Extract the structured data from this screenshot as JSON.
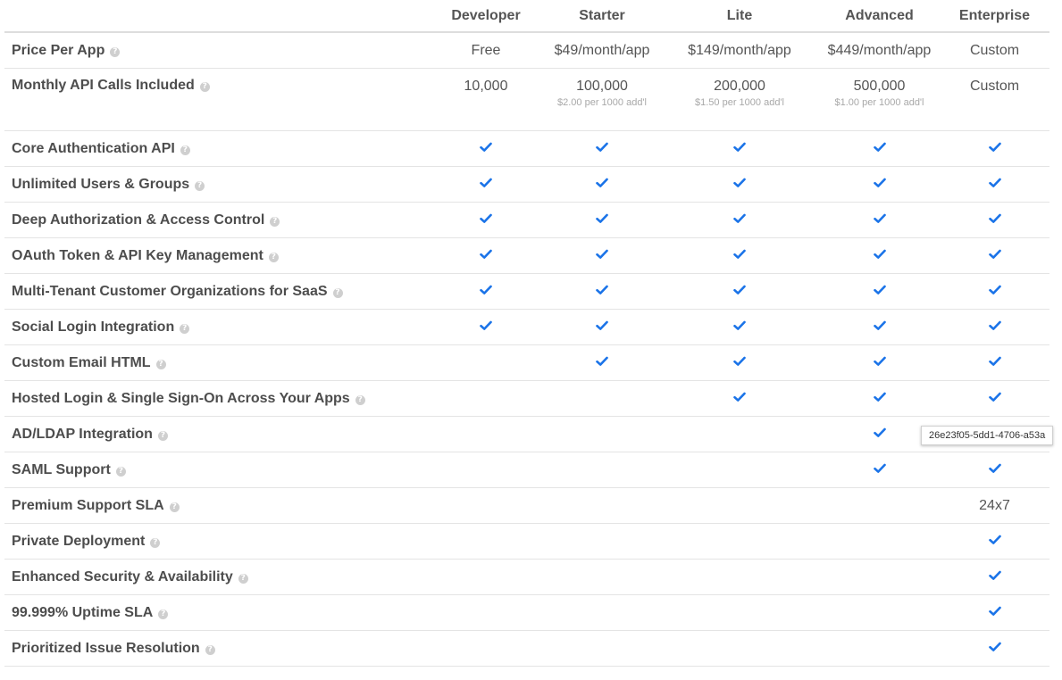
{
  "plans": [
    "Developer",
    "Starter",
    "Lite",
    "Advanced",
    "Enterprise"
  ],
  "colors": {
    "check": "#1a73e8",
    "help_icon": "#cfcfcf",
    "row_border": "#e4e4e4"
  },
  "rows": [
    {
      "label": "Price Per App",
      "cells": [
        {
          "text": "Free"
        },
        {
          "text": "$49/month/app"
        },
        {
          "text": "$149/month/app"
        },
        {
          "text": "$449/month/app"
        },
        {
          "text": "Custom"
        }
      ]
    },
    {
      "label": "Monthly API Calls Included",
      "cells": [
        {
          "text": "10,000"
        },
        {
          "text": "100,000",
          "sub": "$2.00 per 1000 add'l"
        },
        {
          "text": "200,000",
          "sub": "$1.50 per 1000 add'l"
        },
        {
          "text": "500,000",
          "sub": "$1.00 per 1000 add'l"
        },
        {
          "text": "Custom"
        }
      ]
    },
    {
      "label": "Core Authentication API",
      "cells": [
        {
          "check": true
        },
        {
          "check": true
        },
        {
          "check": true
        },
        {
          "check": true
        },
        {
          "check": true
        }
      ]
    },
    {
      "label": "Unlimited Users & Groups",
      "cells": [
        {
          "check": true
        },
        {
          "check": true
        },
        {
          "check": true
        },
        {
          "check": true
        },
        {
          "check": true
        }
      ]
    },
    {
      "label": "Deep Authorization & Access Control",
      "cells": [
        {
          "check": true
        },
        {
          "check": true
        },
        {
          "check": true
        },
        {
          "check": true
        },
        {
          "check": true
        }
      ]
    },
    {
      "label": "OAuth Token & API Key Management",
      "cells": [
        {
          "check": true
        },
        {
          "check": true
        },
        {
          "check": true
        },
        {
          "check": true
        },
        {
          "check": true
        }
      ]
    },
    {
      "label": "Multi-Tenant Customer Organizations for SaaS",
      "cells": [
        {
          "check": true
        },
        {
          "check": true
        },
        {
          "check": true
        },
        {
          "check": true
        },
        {
          "check": true
        }
      ]
    },
    {
      "label": "Social Login Integration",
      "cells": [
        {
          "check": true
        },
        {
          "check": true
        },
        {
          "check": true
        },
        {
          "check": true
        },
        {
          "check": true
        }
      ]
    },
    {
      "label": "Custom Email HTML",
      "cells": [
        {},
        {
          "check": true
        },
        {
          "check": true
        },
        {
          "check": true
        },
        {
          "check": true
        }
      ]
    },
    {
      "label": "Hosted Login & Single Sign-On Across Your Apps",
      "cells": [
        {},
        {},
        {
          "check": true
        },
        {
          "check": true
        },
        {
          "check": true
        }
      ]
    },
    {
      "label": "AD/LDAP Integration",
      "cells": [
        {},
        {},
        {},
        {
          "check": true
        },
        {
          "check": true
        }
      ]
    },
    {
      "label": "SAML Support",
      "cells": [
        {},
        {},
        {},
        {
          "check": true
        },
        {
          "check": true
        }
      ]
    },
    {
      "label": "Premium Support SLA",
      "cells": [
        {},
        {},
        {},
        {},
        {
          "text": "24x7"
        }
      ]
    },
    {
      "label": "Private Deployment",
      "cells": [
        {},
        {},
        {},
        {},
        {
          "check": true
        }
      ]
    },
    {
      "label": "Enhanced Security & Availability",
      "cells": [
        {},
        {},
        {},
        {},
        {
          "check": true
        }
      ]
    },
    {
      "label": "99.999% Uptime SLA",
      "cells": [
        {},
        {},
        {},
        {},
        {
          "check": true
        }
      ]
    },
    {
      "label": "Prioritized Issue Resolution",
      "cells": [
        {},
        {},
        {},
        {},
        {
          "check": true
        }
      ]
    }
  ],
  "tooltip": {
    "text": "26e23f05-5dd1-4706-a53a"
  },
  "icons": {
    "help": "question-circle-icon",
    "check": "checkmark-icon"
  }
}
